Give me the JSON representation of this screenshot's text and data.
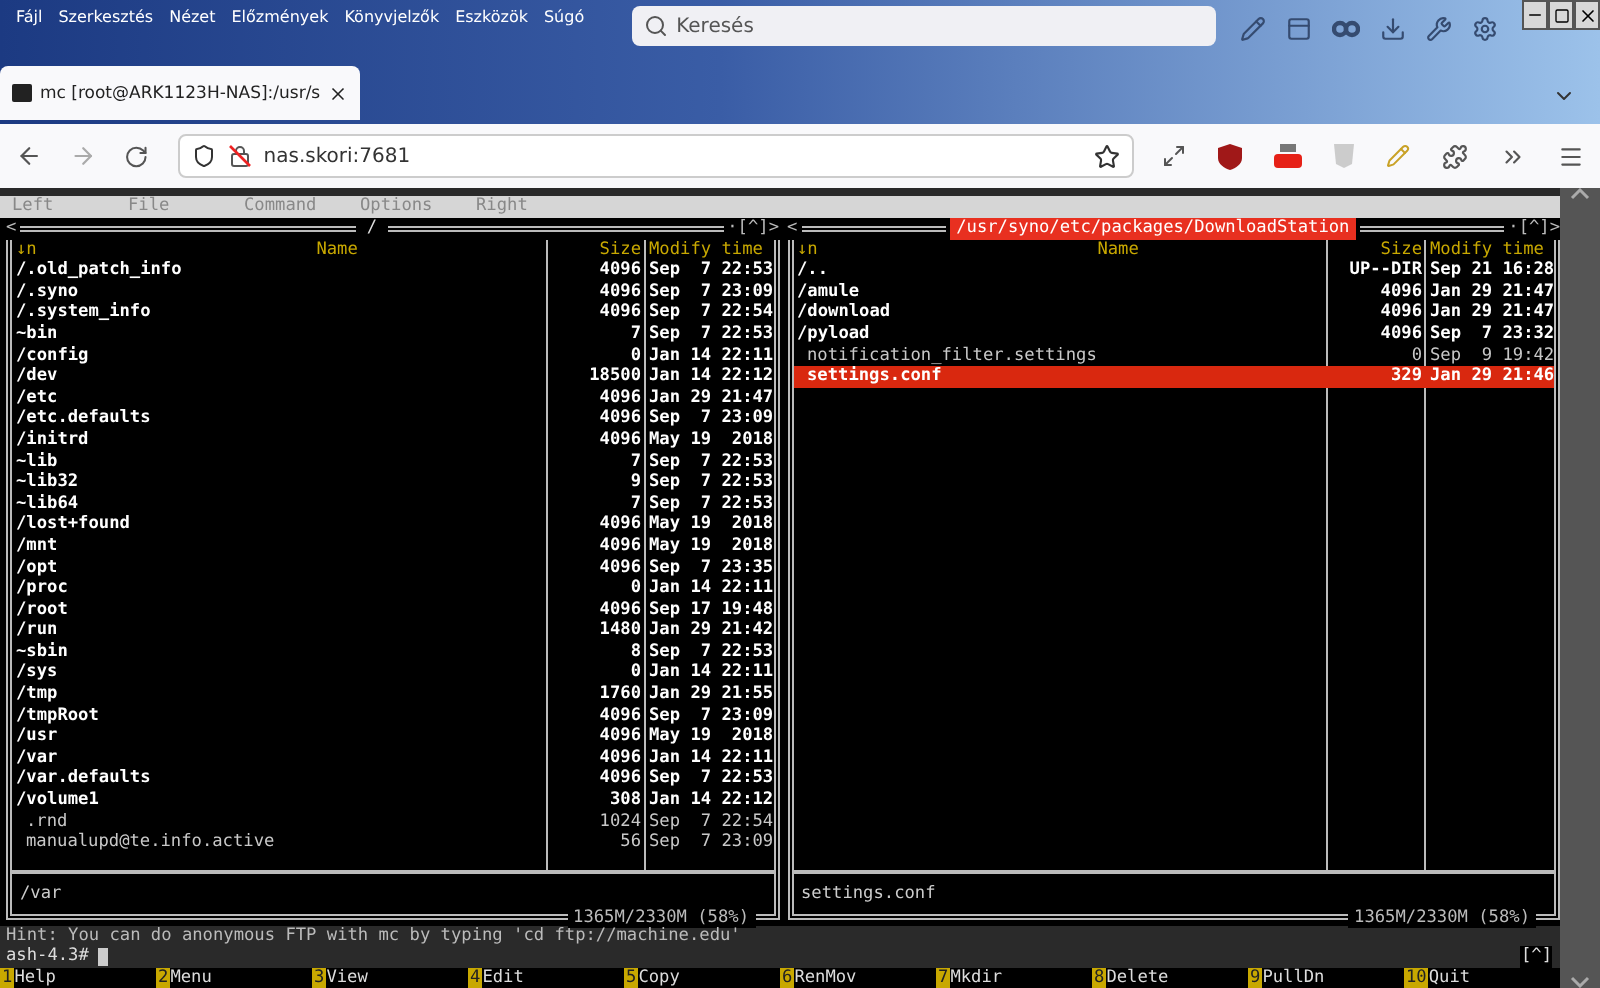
{
  "browser": {
    "menu": [
      "Fájl",
      "Szerkesztés",
      "Nézet",
      "Előzmények",
      "Könyvjelzők",
      "Eszközök",
      "Súgó"
    ],
    "search": {
      "placeholder": "Keresés"
    },
    "tabs": [
      {
        "title": "mc [root@ARK1123H-NAS]:/usr/s",
        "selected": true
      }
    ],
    "address": "nas.skori:7681"
  },
  "mc": {
    "menu": [
      "Left",
      "File",
      "Command",
      "Options",
      "Right"
    ],
    "panels": [
      {
        "path": "/",
        "active": false,
        "edge_left": "<",
        "edge_right": "·[^]>",
        "columns": [
          "↓n",
          "Name",
          "Size",
          "Modify time"
        ],
        "status": "/var",
        "usage": "1365M/2330M (58%)",
        "rows": [
          {
            "name": "/.old_patch_info",
            "size": "4096",
            "time": "Sep  7 22:53",
            "kind": "dir",
            "selected": false
          },
          {
            "name": "/.syno",
            "size": "4096",
            "time": "Sep  7 23:09",
            "kind": "dir",
            "selected": false
          },
          {
            "name": "/.system_info",
            "size": "4096",
            "time": "Sep  7 22:54",
            "kind": "dir",
            "selected": false
          },
          {
            "name": "~bin",
            "size": "7",
            "time": "Sep  7 22:53",
            "kind": "dir",
            "selected": false
          },
          {
            "name": "/config",
            "size": "0",
            "time": "Jan 14 22:11",
            "kind": "dir",
            "selected": false
          },
          {
            "name": "/dev",
            "size": "18500",
            "time": "Jan 14 22:12",
            "kind": "dir",
            "selected": false
          },
          {
            "name": "/etc",
            "size": "4096",
            "time": "Jan 29 21:47",
            "kind": "dir",
            "selected": false
          },
          {
            "name": "/etc.defaults",
            "size": "4096",
            "time": "Sep  7 23:09",
            "kind": "dir",
            "selected": false
          },
          {
            "name": "/initrd",
            "size": "4096",
            "time": "May 19  2018",
            "kind": "dir",
            "selected": false
          },
          {
            "name": "~lib",
            "size": "7",
            "time": "Sep  7 22:53",
            "kind": "dir",
            "selected": false
          },
          {
            "name": "~lib32",
            "size": "9",
            "time": "Sep  7 22:53",
            "kind": "dir",
            "selected": false
          },
          {
            "name": "~lib64",
            "size": "7",
            "time": "Sep  7 22:53",
            "kind": "dir",
            "selected": false
          },
          {
            "name": "/lost+found",
            "size": "4096",
            "time": "May 19  2018",
            "kind": "dir",
            "selected": false
          },
          {
            "name": "/mnt",
            "size": "4096",
            "time": "May 19  2018",
            "kind": "dir",
            "selected": false
          },
          {
            "name": "/opt",
            "size": "4096",
            "time": "Sep  7 23:35",
            "kind": "dir",
            "selected": false
          },
          {
            "name": "/proc",
            "size": "0",
            "time": "Jan 14 22:11",
            "kind": "dir",
            "selected": false
          },
          {
            "name": "/root",
            "size": "4096",
            "time": "Sep 17 19:48",
            "kind": "dir",
            "selected": false
          },
          {
            "name": "/run",
            "size": "1480",
            "time": "Jan 29 21:42",
            "kind": "dir",
            "selected": false
          },
          {
            "name": "~sbin",
            "size": "8",
            "time": "Sep  7 22:53",
            "kind": "dir",
            "selected": false
          },
          {
            "name": "/sys",
            "size": "0",
            "time": "Jan 14 22:11",
            "kind": "dir",
            "selected": false
          },
          {
            "name": "/tmp",
            "size": "1760",
            "time": "Jan 29 21:55",
            "kind": "dir",
            "selected": false
          },
          {
            "name": "/tmpRoot",
            "size": "4096",
            "time": "Sep  7 23:09",
            "kind": "dir",
            "selected": false
          },
          {
            "name": "/usr",
            "size": "4096",
            "time": "May 19  2018",
            "kind": "dir",
            "selected": false
          },
          {
            "name": "/var",
            "size": "4096",
            "time": "Jan 14 22:11",
            "kind": "dir",
            "selected": false
          },
          {
            "name": "/var.defaults",
            "size": "4096",
            "time": "Sep  7 22:53",
            "kind": "dir",
            "selected": false
          },
          {
            "name": "/volume1",
            "size": "308",
            "time": "Jan 14 22:12",
            "kind": "dir",
            "selected": false
          },
          {
            "name": ".rnd",
            "size": "1024",
            "time": "Sep  7 22:54",
            "kind": "file",
            "selected": false
          },
          {
            "name": "manualupd@te.info.active",
            "size": "56",
            "time": "Sep  7 23:09",
            "kind": "file",
            "selected": false
          }
        ]
      },
      {
        "path": "/usr/syno/etc/packages/DownloadStation",
        "active": true,
        "edge_left": "<",
        "edge_right": "·[^]>",
        "columns": [
          "↓n",
          "Name",
          "Size",
          "Modify time"
        ],
        "status": "settings.conf",
        "usage": "1365M/2330M (58%)",
        "rows": [
          {
            "name": "/..",
            "size": "UP--DIR",
            "time": "Sep 21 16:28",
            "kind": "dir",
            "selected": false
          },
          {
            "name": "/amule",
            "size": "4096",
            "time": "Jan 29 21:47",
            "kind": "dir",
            "selected": false
          },
          {
            "name": "/download",
            "size": "4096",
            "time": "Jan 29 21:47",
            "kind": "dir",
            "selected": false
          },
          {
            "name": "/pyload",
            "size": "4096",
            "time": "Sep  7 23:32",
            "kind": "dir",
            "selected": false
          },
          {
            "name": "notification_filter.settings",
            "size": "0",
            "time": "Sep  9 19:42",
            "kind": "file",
            "selected": false
          },
          {
            "name": "settings.conf",
            "size": "329",
            "time": "Jan 29 21:46",
            "kind": "file",
            "selected": true
          }
        ]
      }
    ],
    "hint": "Hint: You can do anonymous FTP with mc by typing 'cd ftp://machine.edu'",
    "prompt": "ash-4.3#",
    "corner": "[^]",
    "fkeys": [
      {
        "key": "1",
        "label": "Help"
      },
      {
        "key": "2",
        "label": "Menu"
      },
      {
        "key": "3",
        "label": "View"
      },
      {
        "key": "4",
        "label": "Edit"
      },
      {
        "key": "5",
        "label": "Copy"
      },
      {
        "key": "6",
        "label": "RenMov"
      },
      {
        "key": "7",
        "label": "Mkdir"
      },
      {
        "key": "8",
        "label": "Delete"
      },
      {
        "key": "9",
        "label": "PullDn"
      },
      {
        "key": "10",
        "label": "Quit"
      }
    ]
  }
}
